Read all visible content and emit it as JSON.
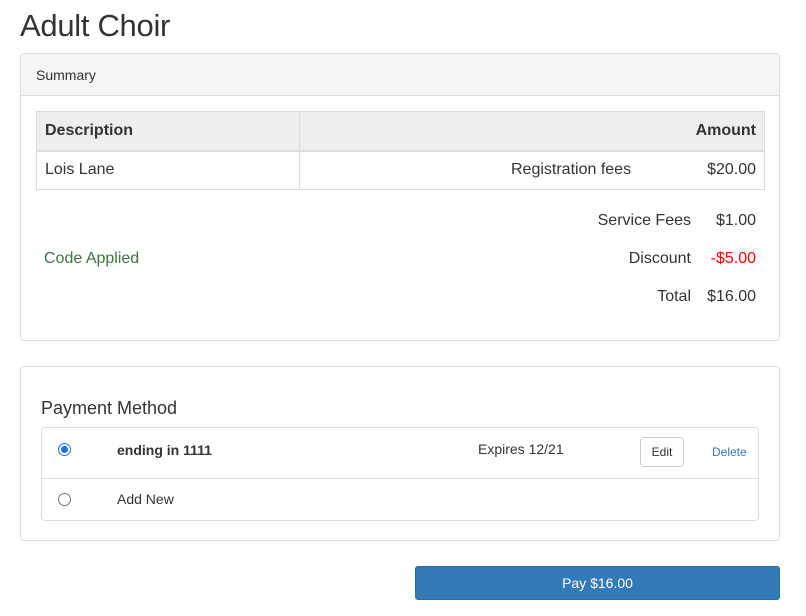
{
  "page": {
    "title": "Adult Choir"
  },
  "summary": {
    "header": "Summary",
    "columns": {
      "description": "Description",
      "amount": "Amount"
    },
    "rows": [
      {
        "description": "Lois Lane",
        "fee_type": "Registration fees",
        "amount": "$20.00"
      }
    ],
    "service_fees_label": "Service Fees",
    "service_fees_value": "$1.00",
    "code_status": "Code Applied",
    "discount_label": "Discount",
    "discount_value": "-$5.00",
    "total_label": "Total",
    "total_value": "$16.00"
  },
  "payment": {
    "title": "Payment Method",
    "methods": [
      {
        "label": "ending in 1111",
        "expires": "Expires 12/21",
        "edit_label": "Edit",
        "delete_label": "Delete",
        "selected": true
      },
      {
        "label": "Add New",
        "selected": false
      }
    ]
  },
  "pay_button": {
    "label": "Pay $16.00"
  },
  "colors": {
    "primary": "#337ab7",
    "success_text": "#3c763d",
    "discount_text": "#ff0000",
    "radio_accent": "#1a73e8"
  }
}
